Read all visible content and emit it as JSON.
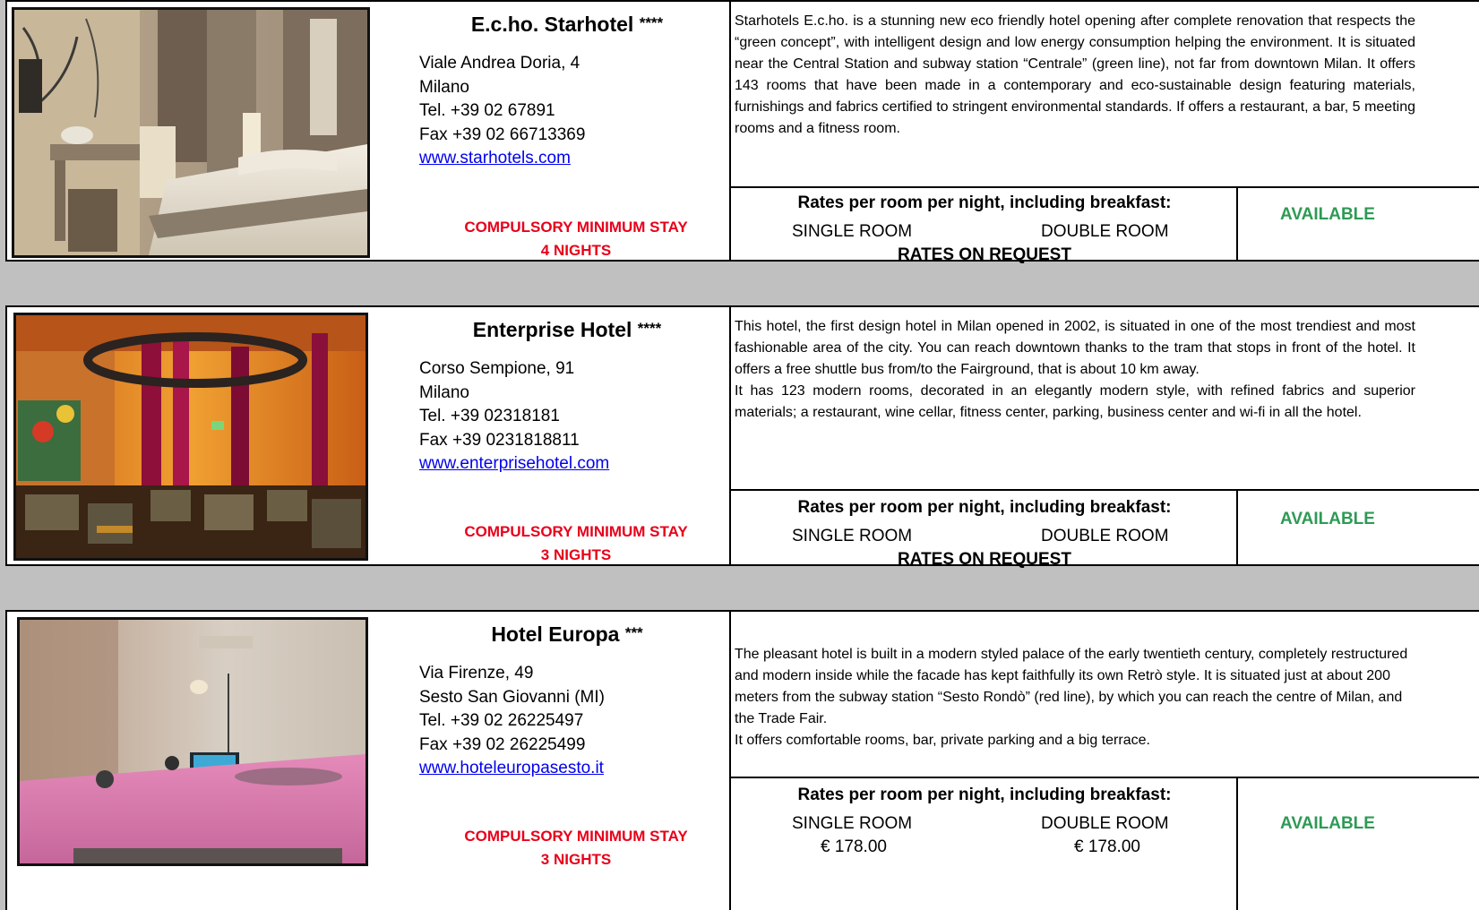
{
  "labels": {
    "rates_title": "Rates per room per night, including breakfast:",
    "single_room": "SINGLE ROOM",
    "double_room": "DOUBLE ROOM",
    "min_stay": "COMPULSORY MINIMUM STAY",
    "available": "AVAILABLE",
    "rates_on_request": "RATES ON REQUEST"
  },
  "hotels": [
    {
      "name": "E.c.ho. Starhotel",
      "stars": "****",
      "address_lines": [
        "Viale Andrea Doria, 4",
        "Milano",
        "Tel. +39 02 67891",
        "Fax +39 02 66713369"
      ],
      "website": "www.starhotels.com",
      "min_stay_nights": "4 NIGHTS",
      "description": [
        "Starhotels E.c.ho. is a stunning new eco friendly hotel opening after complete renovation that respects the “green concept”, with intelligent design and low energy consumption helping the environment. It is situated near the Central Station and subway station “Centrale” (green line), not far from downtown Milan. It offers 143 rooms that have been made in a contemporary and eco-sustainable design featuring materials, furnishings and fabrics certified to stringent environmental standards. If offers a restaurant, a bar, 5 meeting rooms and a fitness room."
      ],
      "rates": "RATES ON REQUEST",
      "status": "AVAILABLE"
    },
    {
      "name": "Enterprise Hotel",
      "stars": "****",
      "address_lines": [
        "Corso Sempione, 91",
        "Milano",
        "Tel. +39 02318181",
        "Fax +39 0231818811"
      ],
      "website": "www.enterprisehotel.com",
      "min_stay_nights": "3 NIGHTS",
      "description": [
        "This hotel, the first design hotel in Milan opened in 2002, is situated in one of the most trendiest and most fashionable area of the city. You can reach downtown thanks to the tram that stops in front of the hotel. It offers a free shuttle bus from/to the Fairground, that is about 10 km away.",
        "It has 123 modern rooms, decorated in an elegantly modern style, with refined fabrics and superior materials; a restaurant, wine cellar, fitness center, parking, business center and wi-fi in all the hotel."
      ],
      "rates": "RATES ON REQUEST",
      "status": "AVAILABLE"
    },
    {
      "name": "Hotel Europa",
      "stars": "***",
      "address_lines": [
        "Via Firenze, 49",
        "Sesto San Giovanni (MI)",
        "Tel. +39 02 26225497",
        "Fax +39 02 26225499"
      ],
      "website": "www.hoteleuropasesto.it",
      "min_stay_nights": "3 NIGHTS",
      "description": [
        "The pleasant hotel is built in a modern styled palace of the early twentieth century, completely restructured and modern inside while the facade has kept faithfully its own Retrò style. It is situated just at about 200 meters from the subway station “Sesto Rondò” (red line), by which you can reach the centre of Milan, and the Trade Fair.",
        "It offers comfortable rooms, bar, private parking and a big terrace."
      ],
      "single_price": "€ 178.00",
      "double_price": "€ 178.00",
      "status": "AVAILABLE"
    }
  ]
}
